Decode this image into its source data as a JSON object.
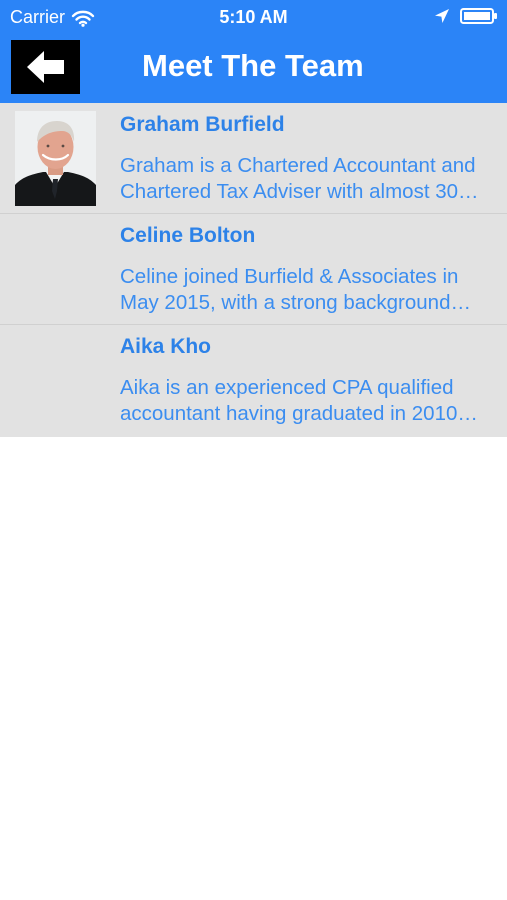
{
  "status_bar": {
    "carrier": "Carrier",
    "time": "5:10 AM",
    "icons": [
      "wifi-icon",
      "location-arrow-icon",
      "battery-icon"
    ]
  },
  "nav": {
    "title": "Meet The Team",
    "back_icon": "back-arrow-icon"
  },
  "team": [
    {
      "name": "Graham Burfield",
      "bio_lines": [
        "Graham is a Chartered Accountant and",
        "Chartered Tax Adviser with almost 30…"
      ],
      "has_photo": true
    },
    {
      "name": "Celine Bolton",
      "bio_lines": [
        "Celine joined Burfield & Associates in",
        "May 2015, with a strong background…"
      ],
      "has_photo": false
    },
    {
      "name": "Aika Kho",
      "bio_lines": [
        "Aika is an experienced CPA qualified",
        "accountant having graduated in 2010…"
      ],
      "has_photo": false
    }
  ],
  "colors": {
    "nav_background": "#2b84f7",
    "list_background": "#e2e2e2",
    "name_text": "#2d82e8",
    "bio_text": "#3b8df0",
    "back_button": "#000000"
  }
}
